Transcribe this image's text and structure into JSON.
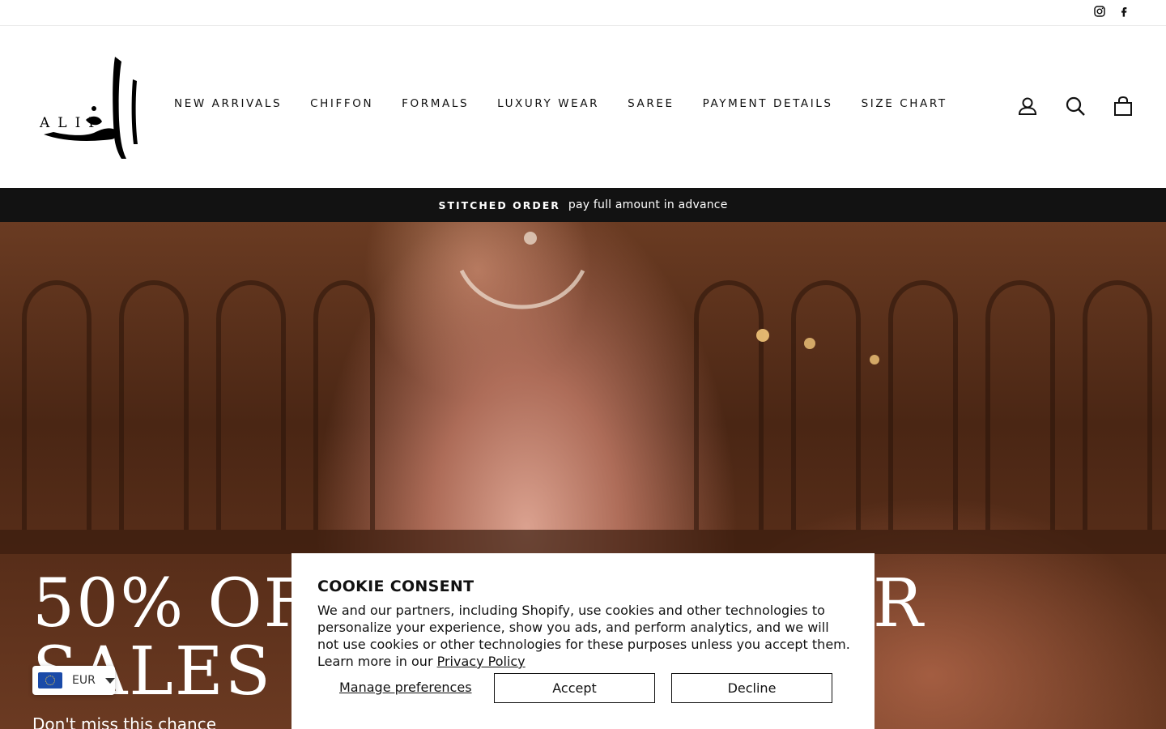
{
  "util_bar": {
    "social_icons": [
      "instagram-icon",
      "facebook-icon"
    ]
  },
  "header": {
    "logo_text": "ALIF",
    "nav": [
      "NEW ARRIVALS",
      "CHIFFON",
      "FORMALS",
      "LUXURY WEAR",
      "SAREE",
      "PAYMENT DETAILS",
      "SIZE CHART"
    ],
    "icons": [
      "user-icon",
      "search-icon",
      "cart-icon"
    ]
  },
  "announcement": {
    "strong": "STITCHED ORDER",
    "text": "pay full amount in advance"
  },
  "hero": {
    "title_line1": "50% OF",
    "title_line2": "SALES A",
    "title_right": "R",
    "subtitle": "Don't miss this chance"
  },
  "currency": {
    "code": "EUR",
    "flag": "eu-flag-icon"
  },
  "cookie": {
    "title": "COOKIE CONSENT",
    "body": "We and our partners, including Shopify, use cookies and other technologies to personalize your experience, show you ads, and perform analytics, and we will not use cookies or other technologies for these purposes unless you accept them. Learn more in our ",
    "privacy_link": "Privacy Policy",
    "manage_label": "Manage preferences",
    "accept_label": "Accept",
    "decline_label": "Decline"
  },
  "colors": {
    "announcement_bg": "#121212",
    "text": "#111111",
    "hero_tone": "#5a2f1a",
    "flag_blue": "#1a4aa8"
  }
}
